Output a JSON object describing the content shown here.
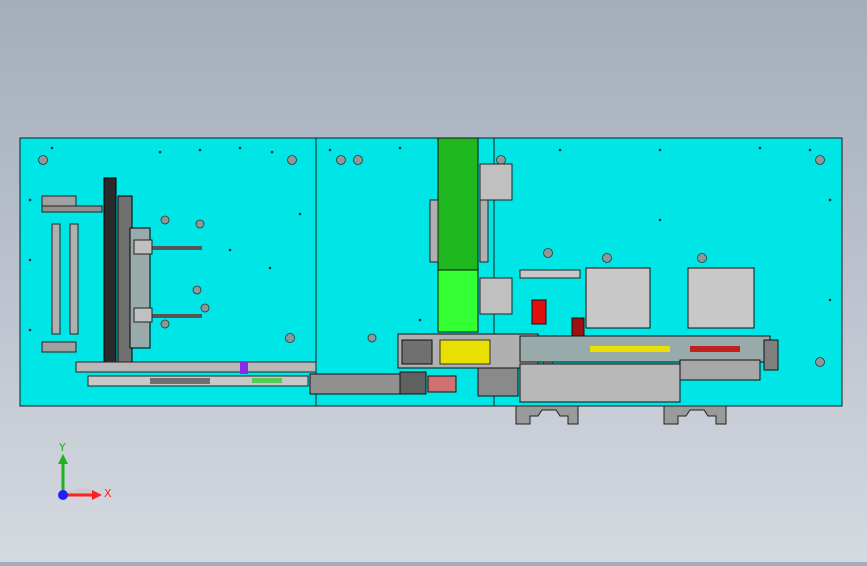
{
  "viewport": {
    "background_top": "#a5adbb",
    "background_bottom": "#d5d9e0"
  },
  "model": {
    "plate_color": "#00e5e5",
    "outline_color": "#1a1a1a",
    "hopper_color": "#1fb81f",
    "hopper_light_color": "#33ff33",
    "block_color": "#c8c8c8",
    "accent_red": "#e01010",
    "accent_yellow": "#e8e000",
    "accent_purple": "#8a2be2"
  },
  "triad": {
    "x_label": "X",
    "y_label": "Y",
    "x_color": "#ff2020",
    "y_color": "#20b020",
    "z_color": "#2020ff"
  }
}
